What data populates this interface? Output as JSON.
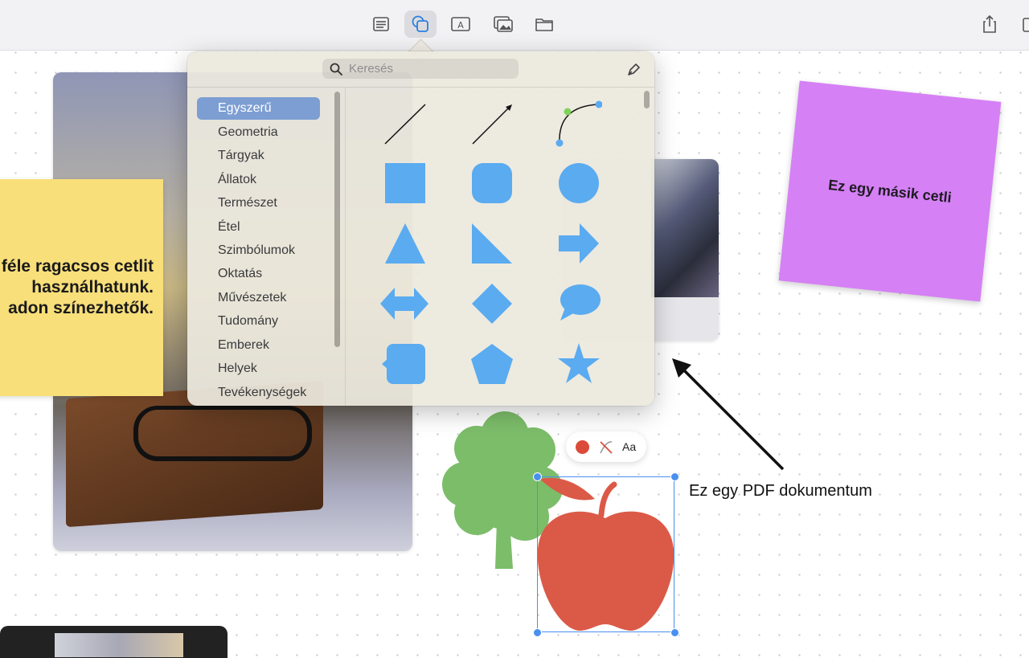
{
  "toolbar": {
    "buttons": [
      {
        "name": "text-box-list-icon",
        "active": false
      },
      {
        "name": "shapes-icon",
        "active": true
      },
      {
        "name": "text-box-icon",
        "active": false
      },
      {
        "name": "media-icon",
        "active": false
      },
      {
        "name": "folder-icon",
        "active": false
      }
    ],
    "right_buttons": [
      "share-icon"
    ]
  },
  "colors": {
    "accent": "#4a90f0",
    "shape_blue": "#5aabf0",
    "sticky_yellow": "#f8df7a",
    "sticky_purple": "#d580f5",
    "tree_green": "#7cbd6a",
    "apple_red": "#db5a47"
  },
  "canvas": {
    "yellow_note": {
      "lines": [
        "féle ragacsos cetlit",
        "használhatunk.",
        "adon színezhetők."
      ]
    },
    "purple_note": {
      "text": "Ez egy másik cetli"
    },
    "pdf_label": "Ez egy PDF dokumentum",
    "mini_toolbar": {
      "text_style": "Aa"
    }
  },
  "shapes_popover": {
    "search": {
      "placeholder": "Keresés"
    },
    "categories": [
      {
        "label": "Egyszerű",
        "selected": true
      },
      {
        "label": "Geometria",
        "selected": false
      },
      {
        "label": "Tárgyak",
        "selected": false
      },
      {
        "label": "Állatok",
        "selected": false
      },
      {
        "label": "Természet",
        "selected": false
      },
      {
        "label": "Étel",
        "selected": false
      },
      {
        "label": "Szimbólumok",
        "selected": false
      },
      {
        "label": "Oktatás",
        "selected": false
      },
      {
        "label": "Művészetek",
        "selected": false
      },
      {
        "label": "Tudomány",
        "selected": false
      },
      {
        "label": "Emberek",
        "selected": false
      },
      {
        "label": "Helyek",
        "selected": false
      },
      {
        "label": "Tevékenységek",
        "selected": false
      }
    ],
    "shapes": [
      "line",
      "arrow-line",
      "curve",
      "square",
      "rounded-square",
      "circle",
      "triangle",
      "right-triangle",
      "arrow",
      "double-arrow",
      "diamond",
      "speech-bubble",
      "callout-square",
      "pentagon",
      "star"
    ]
  }
}
